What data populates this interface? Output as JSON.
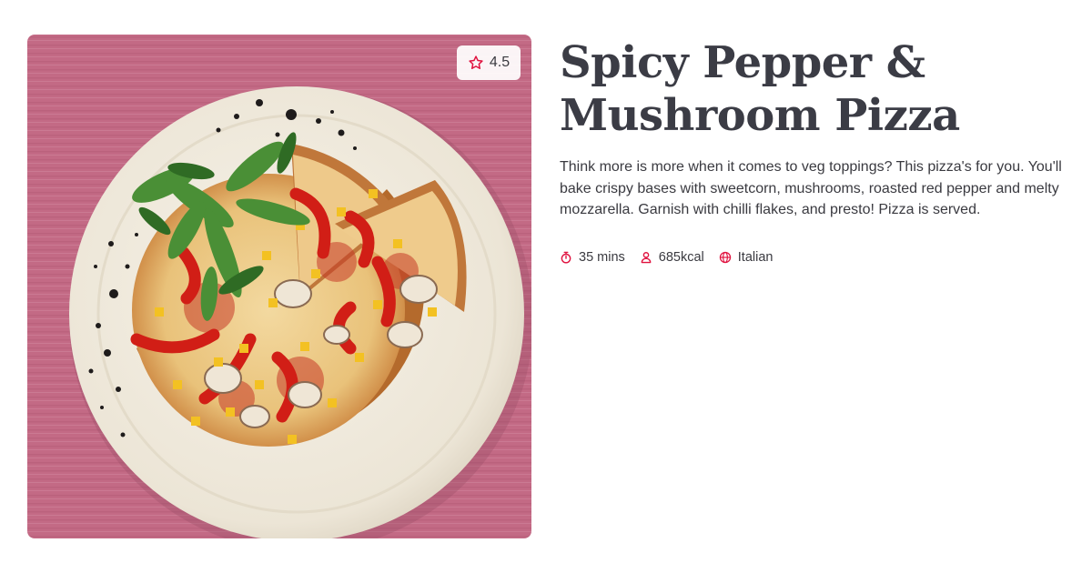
{
  "recipe": {
    "title": "Spicy Pepper & Mushroom Pizza",
    "description": "Think more is more when it comes to veg toppings? This pizza's for you. You'll bake crispy bases with sweetcorn, mushrooms, roasted red pepper and melty mozzarella. Garnish with chilli flakes, and presto! Pizza is served.",
    "rating": "4.5",
    "meta": {
      "time": "35 mins",
      "calories": "685kcal",
      "cuisine": "Italian"
    }
  },
  "colors": {
    "accent": "#e0123f",
    "background_pink": "#c46b86",
    "plate": "#f0ebdf",
    "text": "#3a3a40"
  },
  "icons": {
    "rating": "star-icon",
    "time": "stopwatch-icon",
    "calories": "person-icon",
    "cuisine": "globe-icon"
  }
}
